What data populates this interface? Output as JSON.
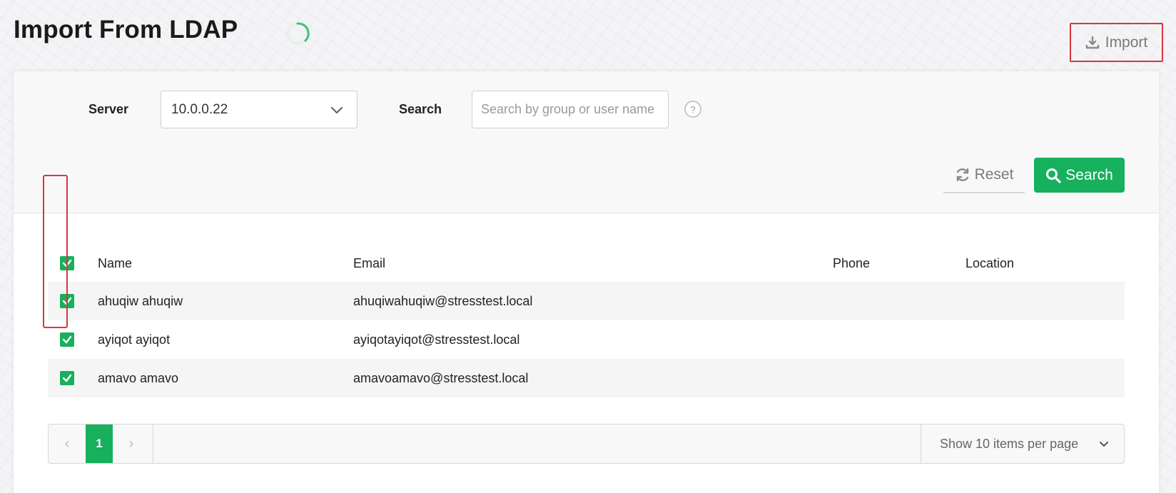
{
  "page": {
    "title": "Import From LDAP"
  },
  "toolbar": {
    "import_label": "Import"
  },
  "filters": {
    "server_label": "Server",
    "server_value": "10.0.0.22",
    "search_label": "Search",
    "search_placeholder": "Search by group or user name",
    "search_value": "",
    "help_symbol": "?",
    "reset_label": "Reset",
    "search_button_label": "Search"
  },
  "table": {
    "columns": {
      "name": "Name",
      "email": "Email",
      "phone": "Phone",
      "location": "Location"
    },
    "select_all_checked": true,
    "rows": [
      {
        "name": "ahuqiw ahuqiw",
        "email": "ahuqiwahuqiw@stresstest.local",
        "phone": "",
        "location": "",
        "checked": true
      },
      {
        "name": "ayiqot ayiqot",
        "email": "ayiqotayiqot@stresstest.local",
        "phone": "",
        "location": "",
        "checked": true
      },
      {
        "name": "amavo amavo",
        "email": "amavoamavo@stresstest.local",
        "phone": "",
        "location": "",
        "checked": true
      }
    ]
  },
  "pagination": {
    "current_page": "1",
    "prev_symbol": "‹",
    "next_symbol": "›",
    "per_page_label": "Show 10 items per page"
  },
  "colors": {
    "accent": "#17b05c",
    "highlight": "#d9363e"
  },
  "icons": [
    "loading-spinner-icon",
    "download-icon",
    "chevron-down-icon",
    "help-icon",
    "refresh-icon",
    "search-icon",
    "checkmark-icon"
  ]
}
